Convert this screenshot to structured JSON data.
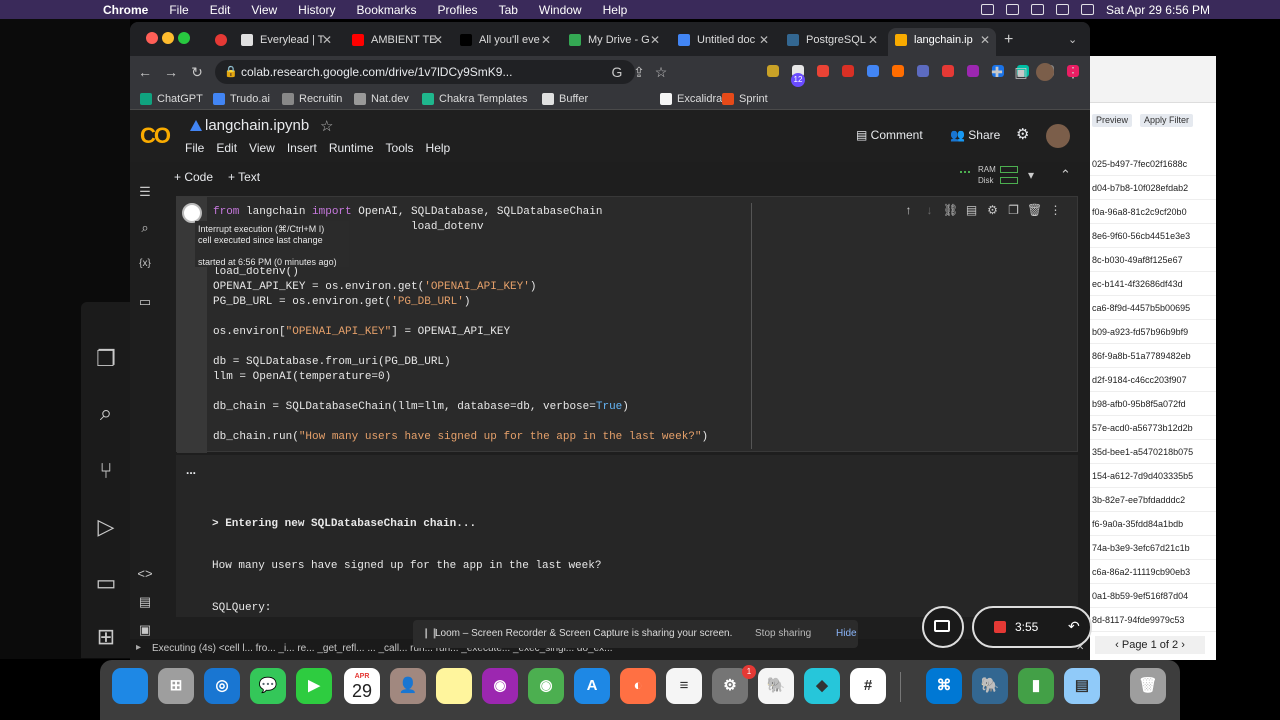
{
  "menubar": {
    "app_name": "Chrome",
    "items": [
      "File",
      "Edit",
      "View",
      "History",
      "Bookmarks",
      "Profiles",
      "Tab",
      "Window",
      "Help"
    ],
    "datetime": "Sat Apr 29  6:56 PM"
  },
  "browser": {
    "tabs": [
      {
        "label": "Everylead | T",
        "icon": "everylead-icon",
        "color": "#e0e0e0"
      },
      {
        "label": "AMBIENT TE",
        "icon": "youtube-icon",
        "color": "#ff0000"
      },
      {
        "label": "All you'll eve",
        "icon": "x-icon",
        "color": "#000000"
      },
      {
        "label": "My Drive - G",
        "icon": "drive-icon",
        "color": "#34a853"
      },
      {
        "label": "Untitled doc",
        "icon": "docs-icon",
        "color": "#4285f4"
      },
      {
        "label": "PostgreSQL",
        "icon": "postgres-icon",
        "color": "#336791"
      },
      {
        "label": "langchain.ip",
        "icon": "colab-icon",
        "color": "#f9ab00"
      }
    ],
    "url": "colab.research.google.com/drive/1v7lDCy9SmK9...",
    "extension_badge": "12",
    "bookmarks": [
      "ChatGPT",
      "Trudo.ai",
      "Recruitin",
      "Nat.dev",
      "Chakra Templates",
      "Buffer",
      "Excalidraw",
      "Sprint"
    ]
  },
  "colab": {
    "logo": "CO",
    "notebook_title": "langchain.ipynb",
    "menu": [
      "File",
      "Edit",
      "View",
      "Insert",
      "Runtime",
      "Tools",
      "Help"
    ],
    "comment_label": "Comment",
    "share_label": "Share",
    "add_code": "+ Code",
    "add_text": "+ Text",
    "ram_label": "RAM",
    "disk_label": "Disk",
    "tooltip": {
      "line1": "Interrupt execution (⌘/Ctrl+M I)",
      "line2": "cell executed since last change",
      "line3": "started at 6:56 PM (0 minutes ago)"
    },
    "code_lines": [
      "from langchain import OpenAI, SQLDatabase, SQLDatabaseChain",
      "load_dotenv",
      "load_dotenv()",
      "OPENAI_API_KEY = os.environ.get('OPENAI_API_KEY')",
      "PG_DB_URL = os.environ.get('PG_DB_URL')",
      "os.environ[\"OPENAI_API_KEY\"] = OPENAI_API_KEY",
      "db = SQLDatabase.from_uri(PG_DB_URL)",
      "llm = OpenAI(temperature=0)",
      "db_chain = SQLDatabaseChain(llm=llm, database=db, verbose=True)",
      "db_chain.run(\"How many users have signed up for the app in the last week?\")"
    ],
    "output_dots": "...",
    "output_lines": [
      "> Entering new SQLDatabaseChain chain...",
      "How many users have signed up for the app in the last week?",
      "SQLQuery:"
    ],
    "status_text": "Executing (4s)  <cell l...  fro...  _i...  re...  _get_refl...  ...  _call...  run...  run...  _execute...  _exec_singl...  do_ex..."
  },
  "right_panel": {
    "preview": "Preview",
    "apply_filter": "Apply Filter",
    "rows": [
      "025-b497-7fec02f1688c",
      "d04-b7b8-10f028efdab2",
      "f0a-96a8-81c2c9cf20b0",
      "8e6-9f60-56cb4451e3e3",
      "8c-b030-49af8f125e67",
      "ec-b141-4f32686df43d",
      "ca6-8f9d-4457b5b00695",
      "b09-a923-fd57b96b9bf9",
      "86f-9a8b-51a7789482eb",
      "d2f-9184-c46cc203f907",
      "b98-afb0-95b8f5a072fd",
      "57e-acd0-a56773b12d2b",
      "35d-bee1-a5470218b075",
      "154-a612-7d9d403335b5",
      "3b-82e7-ee7bfdadddc2",
      "f6-9a0a-35fdd84a1bdb",
      "74a-b3e9-3efc67d21c1b",
      "c6a-86a2-11119cb90eb3",
      "0a1-8b59-9ef516f87d04",
      "8d-8117-94fde9979c53"
    ],
    "page_label": "Page 1 of 2"
  },
  "loom": {
    "message": "Loom – Screen Recorder & Screen Capture is sharing your screen.",
    "stop_label": "Stop sharing",
    "hide_label": "Hide",
    "timer": "3:55"
  },
  "dock": {
    "calendar_month": "APR",
    "calendar_day": "29",
    "settings_badge": "1"
  }
}
